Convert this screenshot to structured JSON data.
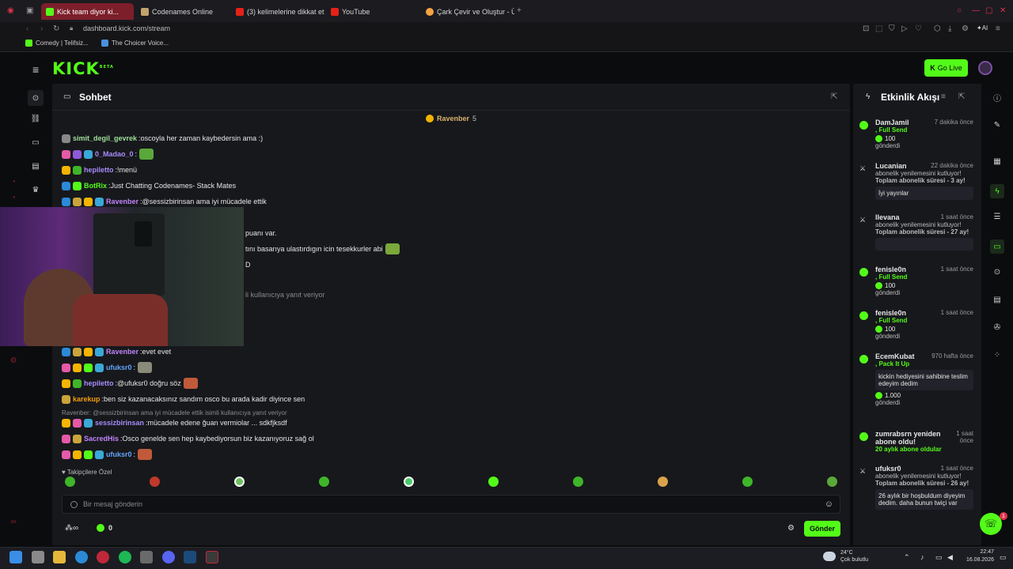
{
  "browser": {
    "tabs": [
      {
        "title": "Kick team diyor ki...",
        "active": true
      },
      {
        "title": "Codenames Online",
        "active": false
      },
      {
        "title": "(3) kelimelerine dikkat et",
        "active": false
      },
      {
        "title": "YouTube",
        "active": false
      },
      {
        "title": "Çark Çevir ve Oluştur - Üc",
        "active": false
      }
    ],
    "url": "dashboard.kick.com/stream",
    "bookmarks": [
      "Comedy | Telifsiz...",
      "The Choicer Voice..."
    ]
  },
  "header": {
    "logo": "KICK",
    "logo_beta": "BETA",
    "go_live": "Go Live"
  },
  "chat": {
    "title": "Sohbet",
    "pinned_user": "Ravenber",
    "pinned_count": "5",
    "messages": [
      {
        "user": "simit_degil_gevrek",
        "sep": ":",
        "text": "oscoyla her zaman kaybedersin ama :)",
        "color": "#9fe09a"
      },
      {
        "user": "0_Madao_0",
        "sep": ":",
        "text": "",
        "color": "#a78bfa"
      },
      {
        "user": "hepiletto",
        "sep": ":",
        "text": "!menü",
        "color": "#a78bfa"
      },
      {
        "user": "BotRix",
        "sep": ":",
        "text": "Just Chatting Codenames- Stack Mates",
        "color": "#53fc18"
      },
      {
        "user": "Ravenber",
        "sep": ":",
        "text": "@sessizbirinsan ama iyi mücadele ettik",
        "color": "#c084fc"
      },
      {
        "user": "",
        "sep": "",
        "text": "puanı var.",
        "color": "#e6e6e6"
      },
      {
        "user": "",
        "sep": "",
        "text": "tını basarıya ulastırdıgın icin tesekkurler abi",
        "color": "#e6e6e6"
      },
      {
        "user": "",
        "sep": "",
        "text": "D",
        "color": "#e6e6e6"
      },
      {
        "user": "",
        "sep": "",
        "text": "li kullanıcıya yanıt veriyor",
        "color": "#8a8a8a"
      },
      {
        "user": "Ravenber",
        "sep": ":",
        "text": "evet evet",
        "color": "#c084fc"
      },
      {
        "user": "ufuksr0",
        "sep": ":",
        "text": "",
        "color": "#60a5fa"
      },
      {
        "user": "hepiletto",
        "sep": ":",
        "text": "@ufuksr0 doğru söz",
        "color": "#a78bfa"
      },
      {
        "user": "karekup",
        "sep": ":",
        "text": "ben siz kazanacaksınız sandım osco bu arada kadir diyince sen",
        "color": "#f59e0b"
      },
      {
        "user": "sessizbirinsan",
        "sep": ":",
        "text": "mücadele edene ğuan vermiolar ... sdkfjksdf",
        "color": "#a78bfa"
      },
      {
        "user": "SacredHis",
        "sep": ":",
        "text": "Osco genelde sen hep kaybediyorsun biz kazanıyoruz sağ ol",
        "color": "#c084fc"
      },
      {
        "user": "ufuksr0",
        "sep": ":",
        "text": "",
        "color": "#60a5fa"
      }
    ],
    "reply_line": "Ravenber: @sessizbirinsan ama iyi mücadele ettik isimli kullanıcıya yanıt veriyor",
    "emote_label": "Takipçilere Özel",
    "input_placeholder": "Bir mesaj gönderin",
    "points": "0",
    "send_label": "Gönder"
  },
  "feed": {
    "title": "Etkinlik Akışı",
    "events": [
      {
        "user": "DamJamil",
        "time": "7 dakika önce",
        "line1": ", Full Send",
        "amount": "100",
        "line3": "gönderdi"
      },
      {
        "user": "Lucanian",
        "time": "22 dakika önce",
        "line1": "abonelik yenilemesini kutluyor!",
        "line2": "Toplam abonelik süresi - 3 ay!",
        "msg": "İyi yayınlar"
      },
      {
        "user": "Ilevana",
        "time": "1 saat önce",
        "line1": "abonelik yenilemesini kutluyor!",
        "line2": "Toplam abonelik süresi - 27 ay!"
      },
      {
        "user": "fenisle0n",
        "time": "1 saat önce",
        "line1": ", Full Send",
        "amount": "100",
        "line3": "gönderdi"
      },
      {
        "user": "fenisle0n",
        "time": "1 saat önce",
        "line1": ", Full Send",
        "amount": "100",
        "line3": "gönderdi"
      },
      {
        "user": "EcemKubat",
        "time": "970 hafta önce",
        "line1": ", Pack It Up",
        "msg": "kickin hediyesini sahibine teslim edeyim dedim",
        "amount": "1.000",
        "line3": "gönderdi"
      },
      {
        "user": "zumrabsrn yeniden abone oldu!",
        "time": "1 saat önce",
        "line1": "20 aylık abone oldular"
      },
      {
        "user": "ufuksr0",
        "time": "1 saat önce",
        "line1": "abonelik yenilemesini kutluyor!",
        "line2": "Toplam abonelik süresi - 26 ay!",
        "msg": "26 aylık bir hoşbuldum diyeyim dedim. daha bunun twiçi var"
      }
    ]
  },
  "taskbar": {
    "weather_temp": "24°C",
    "weather_text": "Çok bulutlu",
    "time": "22:47",
    "date": "16.08.2026"
  },
  "colors": {
    "accent": "#53fc18",
    "panel": "#17181c",
    "bg": "#0b0c0e"
  }
}
